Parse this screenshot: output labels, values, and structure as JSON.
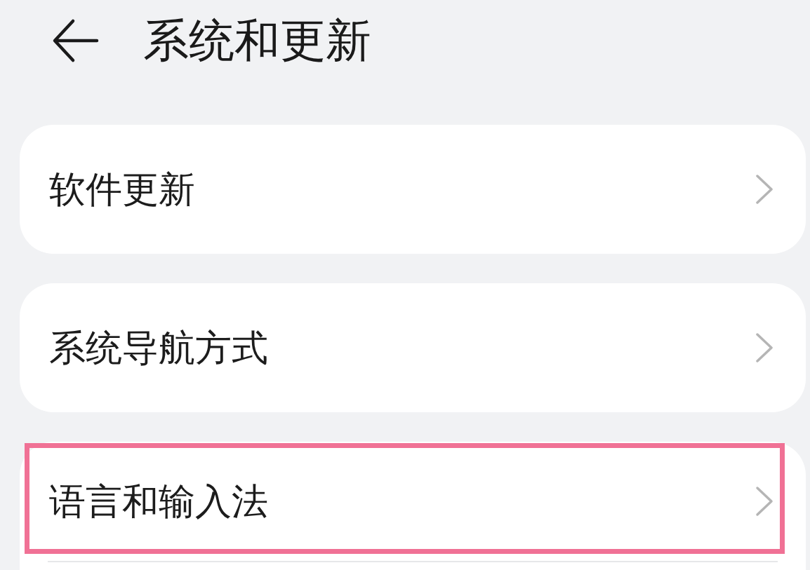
{
  "header": {
    "title": "系统和更新"
  },
  "groups": [
    {
      "continues_below": false,
      "items": [
        {
          "label": "软件更新",
          "highlighted": false
        }
      ]
    },
    {
      "continues_below": false,
      "items": [
        {
          "label": "系统导航方式",
          "highlighted": false
        }
      ]
    },
    {
      "continues_below": true,
      "items": [
        {
          "label": "语言和输入法",
          "highlighted": true
        }
      ]
    }
  ]
}
